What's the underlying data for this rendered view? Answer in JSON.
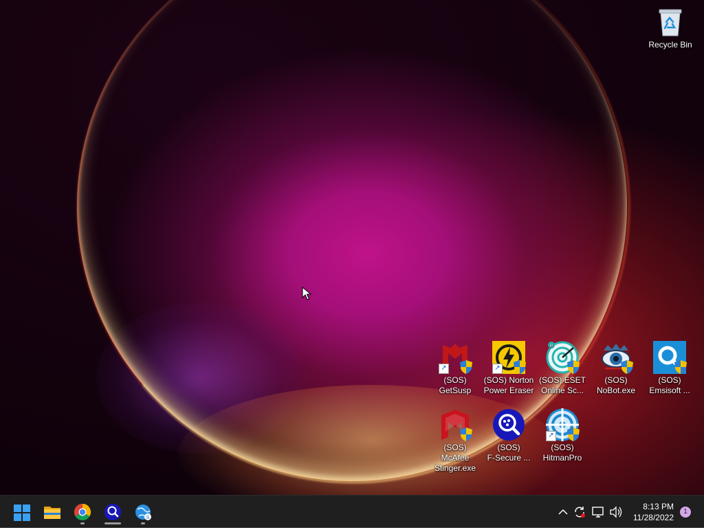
{
  "desktop": {
    "icons": [
      {
        "id": "recycle-bin",
        "label": "Recycle Bin",
        "icon": "recycle-bin-icon"
      },
      {
        "id": "getsusp",
        "label": "(SOS)\nGetSusp",
        "icon": "getsusp-icon"
      },
      {
        "id": "norton",
        "label": "(SOS) Norton\nPower Eraser",
        "icon": "norton-power-eraser-icon"
      },
      {
        "id": "eset",
        "label": "(SOS) ESET\nOnline Sc...",
        "icon": "eset-online-scanner-icon"
      },
      {
        "id": "nobot",
        "label": "(SOS)\nNoBot.exe",
        "icon": "nobot-icon"
      },
      {
        "id": "emsisoft",
        "label": "(SOS)\nEmsisoft ...",
        "icon": "emsisoft-icon"
      },
      {
        "id": "mcafee",
        "label": "(SOS) McAfee\nStinger.exe",
        "icon": "mcafee-stinger-icon"
      },
      {
        "id": "fsecure",
        "label": "(SOS)\nF-Secure ...",
        "icon": "f-secure-icon"
      },
      {
        "id": "hitmanpro",
        "label": "(SOS)\nHitmanPro",
        "icon": "hitmanpro-icon"
      }
    ]
  },
  "taskbar": {
    "apps": [
      {
        "name": "start",
        "icon": "windows-start-icon"
      },
      {
        "name": "file-explorer",
        "icon": "file-explorer-icon"
      },
      {
        "name": "chrome",
        "icon": "chrome-icon"
      },
      {
        "name": "scanner",
        "icon": "scanner-magnifier-icon"
      },
      {
        "name": "globe-app",
        "icon": "globe-app-icon"
      }
    ],
    "tray": {
      "icons": [
        "chevron-up-icon",
        "sync-icon",
        "network-icon",
        "volume-icon"
      ],
      "time": "8:13 PM",
      "date": "11/28/2022",
      "notification_count": "1"
    }
  },
  "colors": {
    "taskbar_bg": "#1f1f1f",
    "wallpaper_center": "#c0128a",
    "accent_blue": "#1a5fd0"
  }
}
